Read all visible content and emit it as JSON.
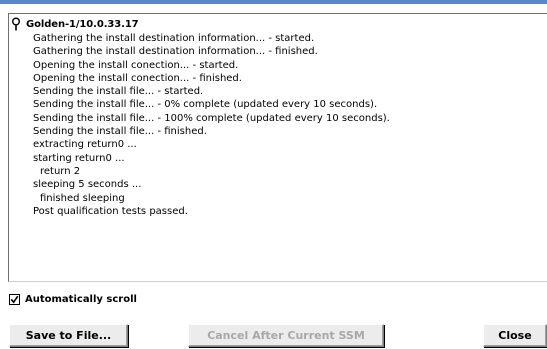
{
  "log": {
    "header": "Golden-1/10.0.33.17",
    "lines": [
      {
        "text": "Gathering the install destination information... - started.",
        "indent": 1
      },
      {
        "text": "Gathering the install destination information... - finished.",
        "indent": 1
      },
      {
        "text": "Opening the install conection... - started.",
        "indent": 1
      },
      {
        "text": "Opening the install conection... - finished.",
        "indent": 1
      },
      {
        "text": "Sending the install file... - started.",
        "indent": 1
      },
      {
        "text": "Sending the install file... - 0% complete (updated every 10 seconds).",
        "indent": 1
      },
      {
        "text": "Sending the install file... - 100% complete (updated every 10 seconds).",
        "indent": 1
      },
      {
        "text": "Sending the install file... - finished.",
        "indent": 1
      },
      {
        "text": "extracting return0 ...",
        "indent": 1
      },
      {
        "text": "starting return0 ...",
        "indent": 1
      },
      {
        "text": "return 2",
        "indent": 2
      },
      {
        "text": "sleeping 5 seconds ...",
        "indent": 1
      },
      {
        "text": "finished sleeping",
        "indent": 2
      },
      {
        "text": "Post qualification tests passed.",
        "indent": 1
      }
    ]
  },
  "options": {
    "auto_scroll_label": "Automatically scroll",
    "auto_scroll_checked": true
  },
  "buttons": {
    "save_label": "Save to File...",
    "cancel_label": "Cancel After Current SSM",
    "cancel_enabled": false,
    "close_label": "Close"
  },
  "icons": {
    "header": "pin-icon",
    "checkmark": "checkmark-icon"
  }
}
